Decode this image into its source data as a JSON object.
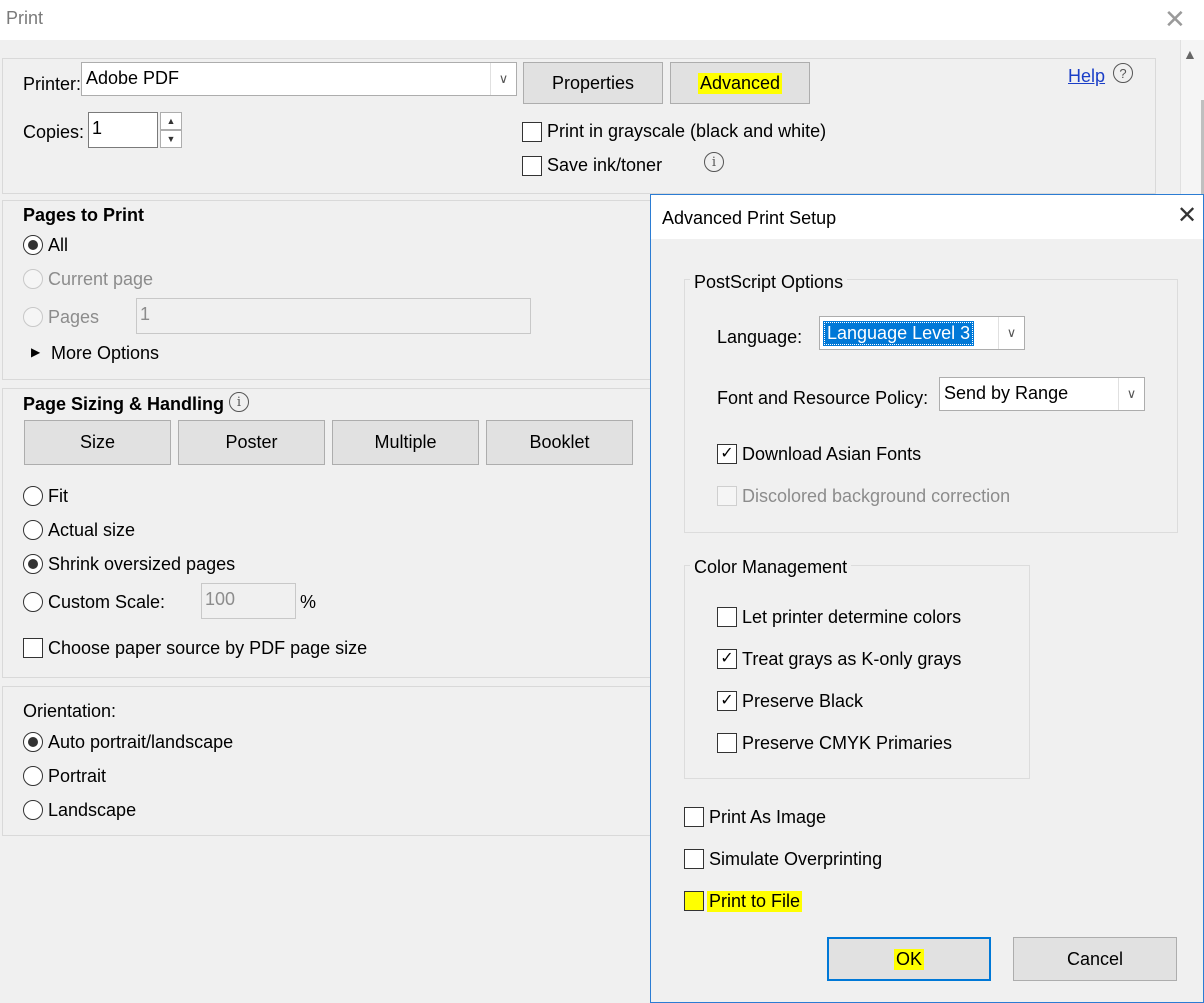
{
  "window": {
    "title": "Print",
    "close_glyph": "✕"
  },
  "printer": {
    "label": "Printer:",
    "value": "Adobe PDF",
    "properties_label": "Properties",
    "advanced_label": "Advanced",
    "help_label": "Help",
    "copies_label": "Copies:",
    "copies_value": "1",
    "grayscale_label": "Print in grayscale (black and white)",
    "grayscale_checked": false,
    "save_ink_label": "Save ink/toner",
    "save_ink_checked": false
  },
  "pages_to_print": {
    "heading": "Pages to Print",
    "all_label": "All",
    "current_label": "Current page",
    "pages_label": "Pages",
    "pages_value": "1",
    "more_options_label": "More Options",
    "selected": "All"
  },
  "sizing": {
    "heading": "Page Sizing & Handling",
    "tabs": [
      "Size",
      "Poster",
      "Multiple",
      "Booklet"
    ],
    "fit_label": "Fit",
    "actual_label": "Actual size",
    "shrink_label": "Shrink oversized pages",
    "custom_label": "Custom Scale:",
    "custom_value": "100",
    "percent": "%",
    "paper_source_label": "Choose paper source by PDF page size",
    "selected": "Shrink oversized pages"
  },
  "orientation": {
    "heading": "Orientation:",
    "auto_label": "Auto portrait/landscape",
    "portrait_label": "Portrait",
    "landscape_label": "Landscape",
    "selected": "Auto portrait/landscape"
  },
  "advanced_dialog": {
    "title": "Advanced Print Setup",
    "postscript": {
      "legend": "PostScript Options",
      "language_label": "Language:",
      "language_value": "Language Level 3",
      "font_policy_label": "Font and Resource Policy:",
      "font_policy_value": "Send by Range",
      "download_asian_label": "Download Asian Fonts",
      "download_asian_checked": true,
      "discolored_label": "Discolored background correction",
      "discolored_checked": false
    },
    "color": {
      "legend": "Color Management",
      "let_printer_label": "Let printer determine colors",
      "let_printer_checked": false,
      "treat_grays_label": "Treat grays as K-only grays",
      "treat_grays_checked": true,
      "preserve_black_label": "Preserve Black",
      "preserve_black_checked": true,
      "preserve_cmyk_label": "Preserve CMYK Primaries",
      "preserve_cmyk_checked": false
    },
    "print_as_image_label": "Print As Image",
    "simulate_overprint_label": "Simulate Overprinting",
    "print_to_file_label": "Print to File",
    "ok_label": "OK",
    "cancel_label": "Cancel"
  },
  "colors": {
    "highlight": "#ffff00",
    "selection": "#0078d7",
    "link": "#1a3ec7"
  }
}
